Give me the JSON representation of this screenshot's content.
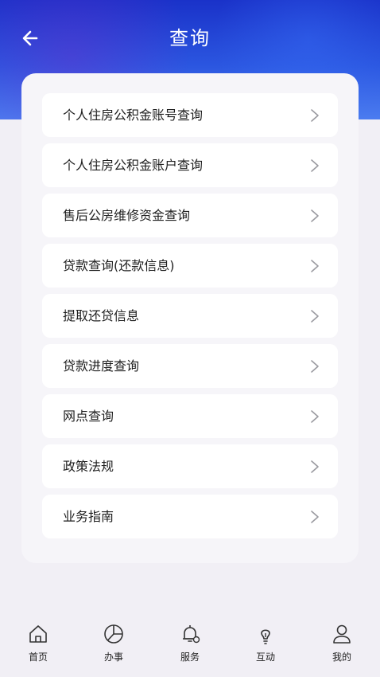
{
  "header": {
    "title": "查询",
    "back_icon": "arrow-left-icon"
  },
  "menu": {
    "items": [
      {
        "label": "个人住房公积金账号查询"
      },
      {
        "label": "个人住房公积金账户查询"
      },
      {
        "label": "售后公房维修资金查询"
      },
      {
        "label": "贷款查询(还款信息)"
      },
      {
        "label": "提取还贷信息"
      },
      {
        "label": "贷款进度查询"
      },
      {
        "label": "网点查询"
      },
      {
        "label": "政策法规"
      },
      {
        "label": "业务指南"
      }
    ]
  },
  "tabbar": {
    "items": [
      {
        "label": "首页",
        "icon": "home-icon"
      },
      {
        "label": "办事",
        "icon": "pie-chart-icon"
      },
      {
        "label": "服务",
        "icon": "bell-icon"
      },
      {
        "label": "互动",
        "icon": "lightbulb-icon"
      },
      {
        "label": "我的",
        "icon": "user-icon"
      }
    ]
  },
  "colors": {
    "header_gradient_top": "#1a32c9",
    "header_gradient_bottom": "#4b7cf0",
    "background": "#f1eff5",
    "card": "#ffffff"
  }
}
